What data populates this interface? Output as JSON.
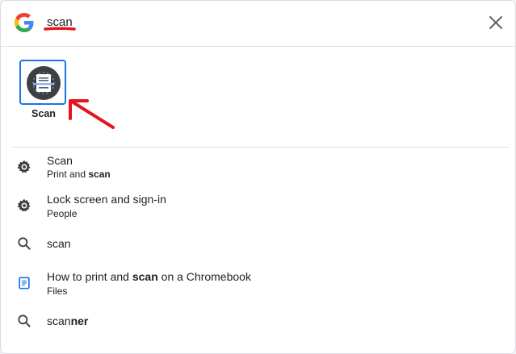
{
  "search": {
    "query": "scan"
  },
  "app_result": {
    "label": "Scan",
    "icon": "scanner-app-icon"
  },
  "results": [
    {
      "icon": "settings-gear-icon",
      "title": "Scan",
      "subtitle_prefix": "Print and ",
      "subtitle_bold": "scan"
    },
    {
      "icon": "settings-gear-icon",
      "title": "Lock screen and sign-in",
      "subtitle": "People"
    },
    {
      "icon": "search-icon",
      "title": "scan"
    },
    {
      "icon": "file-document-icon",
      "title_prefix": "How to print and ",
      "title_bold": "scan",
      "title_suffix": " on a Chromebook",
      "subtitle": "Files"
    },
    {
      "icon": "search-icon",
      "title_prefix": "scan",
      "title_bold": "ner"
    }
  ],
  "colors": {
    "accent": "#1a73e8",
    "annotation": "#e8131b",
    "icon_gray": "#5f6368",
    "icon_dark": "#3c4043"
  }
}
